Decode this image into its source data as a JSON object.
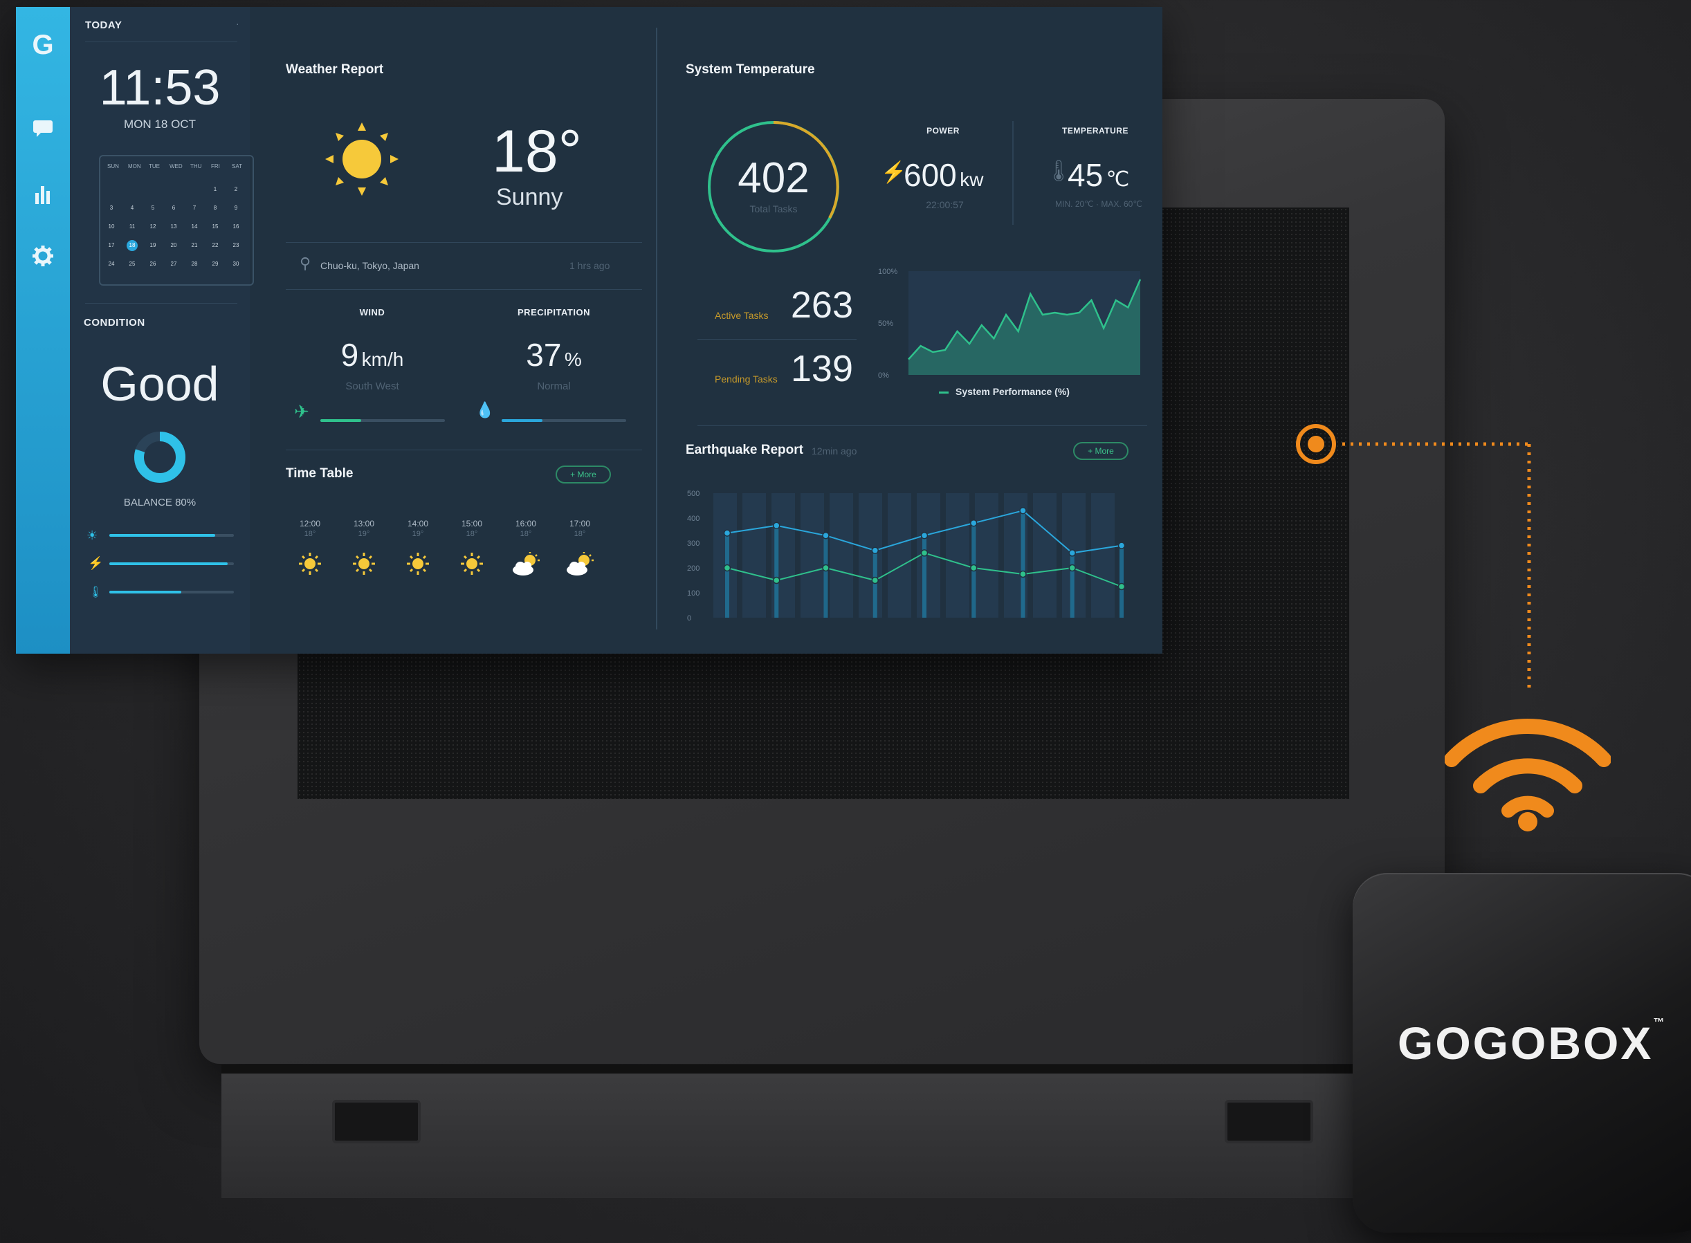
{
  "sidebar": {
    "today_label": "TODAY",
    "time": "11:53",
    "date": "MON 18 OCT",
    "calendar": {
      "weekdays": [
        "SUN",
        "MON",
        "TUE",
        "WED",
        "THU",
        "FRI",
        "SAT"
      ],
      "rows": [
        [
          "",
          "",
          "",
          "",
          "",
          "1",
          "2"
        ],
        [
          "3",
          "4",
          "5",
          "6",
          "7",
          "8",
          "9"
        ],
        [
          "10",
          "11",
          "12",
          "13",
          "14",
          "15",
          "16"
        ],
        [
          "17",
          "18",
          "19",
          "20",
          "21",
          "22",
          "23"
        ],
        [
          "24",
          "25",
          "26",
          "27",
          "28",
          "29",
          "30"
        ]
      ],
      "selected": "18"
    },
    "condition_label": "CONDITION",
    "condition_value": "Good",
    "balance_label": "BALANCE 80%",
    "balance_fraction": 0.8,
    "bars": [
      {
        "icon": "sun-icon",
        "fill": 0.85
      },
      {
        "icon": "bolt-icon",
        "fill": 0.95
      },
      {
        "icon": "thermometer-icon",
        "fill": 0.58
      }
    ]
  },
  "weather": {
    "title": "Weather Report",
    "temp": "18°",
    "condition": "Sunny",
    "location": "Chuo-ku, Tokyo, Japan",
    "updated": "1 hrs ago",
    "wind_label": "WIND",
    "wind_value": "9",
    "wind_unit": "km/h",
    "wind_dir": "South West",
    "wind_fill": 0.33,
    "precip_label": "PRECIPITATION",
    "precip_value": "37",
    "precip_unit": "%",
    "precip_note": "Normal",
    "precip_fill": 0.33
  },
  "timetable": {
    "title": "Time Table",
    "more": "+ More",
    "slots": [
      {
        "time": "12:00",
        "temp": "18°",
        "icon": "sun-icon"
      },
      {
        "time": "13:00",
        "temp": "19°",
        "icon": "sun-icon"
      },
      {
        "time": "14:00",
        "temp": "19°",
        "icon": "sun-icon"
      },
      {
        "time": "15:00",
        "temp": "18°",
        "icon": "sun-icon"
      },
      {
        "time": "16:00",
        "temp": "18°",
        "icon": "partly-cloudy-icon"
      },
      {
        "time": "17:00",
        "temp": "18°",
        "icon": "partly-cloudy-icon"
      }
    ]
  },
  "system": {
    "title": "System Temperature",
    "total_tasks": "402",
    "total_tasks_label": "Total Tasks",
    "power_label": "POWER",
    "power_value": "600",
    "power_unit": "kw",
    "power_time": "22:00:57",
    "temp_label": "TEMPERATURE",
    "temp_value": "45",
    "temp_unit": "℃",
    "temp_range": "MIN. 20℃ · MAX. 60℃",
    "active_label": "Active Tasks",
    "active_value": "263",
    "pending_label": "Pending Tasks",
    "pending_value": "139",
    "perf_legend": "System Performance (%)"
  },
  "earthquake": {
    "title": "Earthquake Report",
    "subtitle": "12min ago",
    "more": "+ More"
  },
  "brand": {
    "box_name": "GOGOBOX",
    "tm": "™"
  },
  "colors": {
    "accent": "#2aa7dc",
    "green": "#2fc18c",
    "orange": "#f08a1c",
    "bg": "#203140"
  },
  "chart_data": [
    {
      "type": "area",
      "title": "",
      "legend": "System Performance (%)",
      "y_ticks": [
        "100%",
        "50%",
        "0%"
      ],
      "ylim": [
        0,
        100
      ],
      "values": [
        15,
        28,
        22,
        24,
        42,
        30,
        48,
        35,
        58,
        42,
        78,
        58,
        60,
        58,
        60,
        72,
        45,
        72,
        65,
        92
      ]
    },
    {
      "type": "line",
      "title": "",
      "y_ticks": [
        "500",
        "400",
        "300",
        "200",
        "100",
        "0"
      ],
      "ylim": [
        0,
        500
      ],
      "x_count": 9,
      "series": [
        {
          "color": "#2aa7dc",
          "values": [
            340,
            370,
            330,
            270,
            330,
            380,
            430,
            260,
            290
          ]
        },
        {
          "color": "#2fc18c",
          "values": [
            200,
            150,
            200,
            150,
            260,
            200,
            175,
            200,
            125
          ]
        }
      ]
    }
  ]
}
